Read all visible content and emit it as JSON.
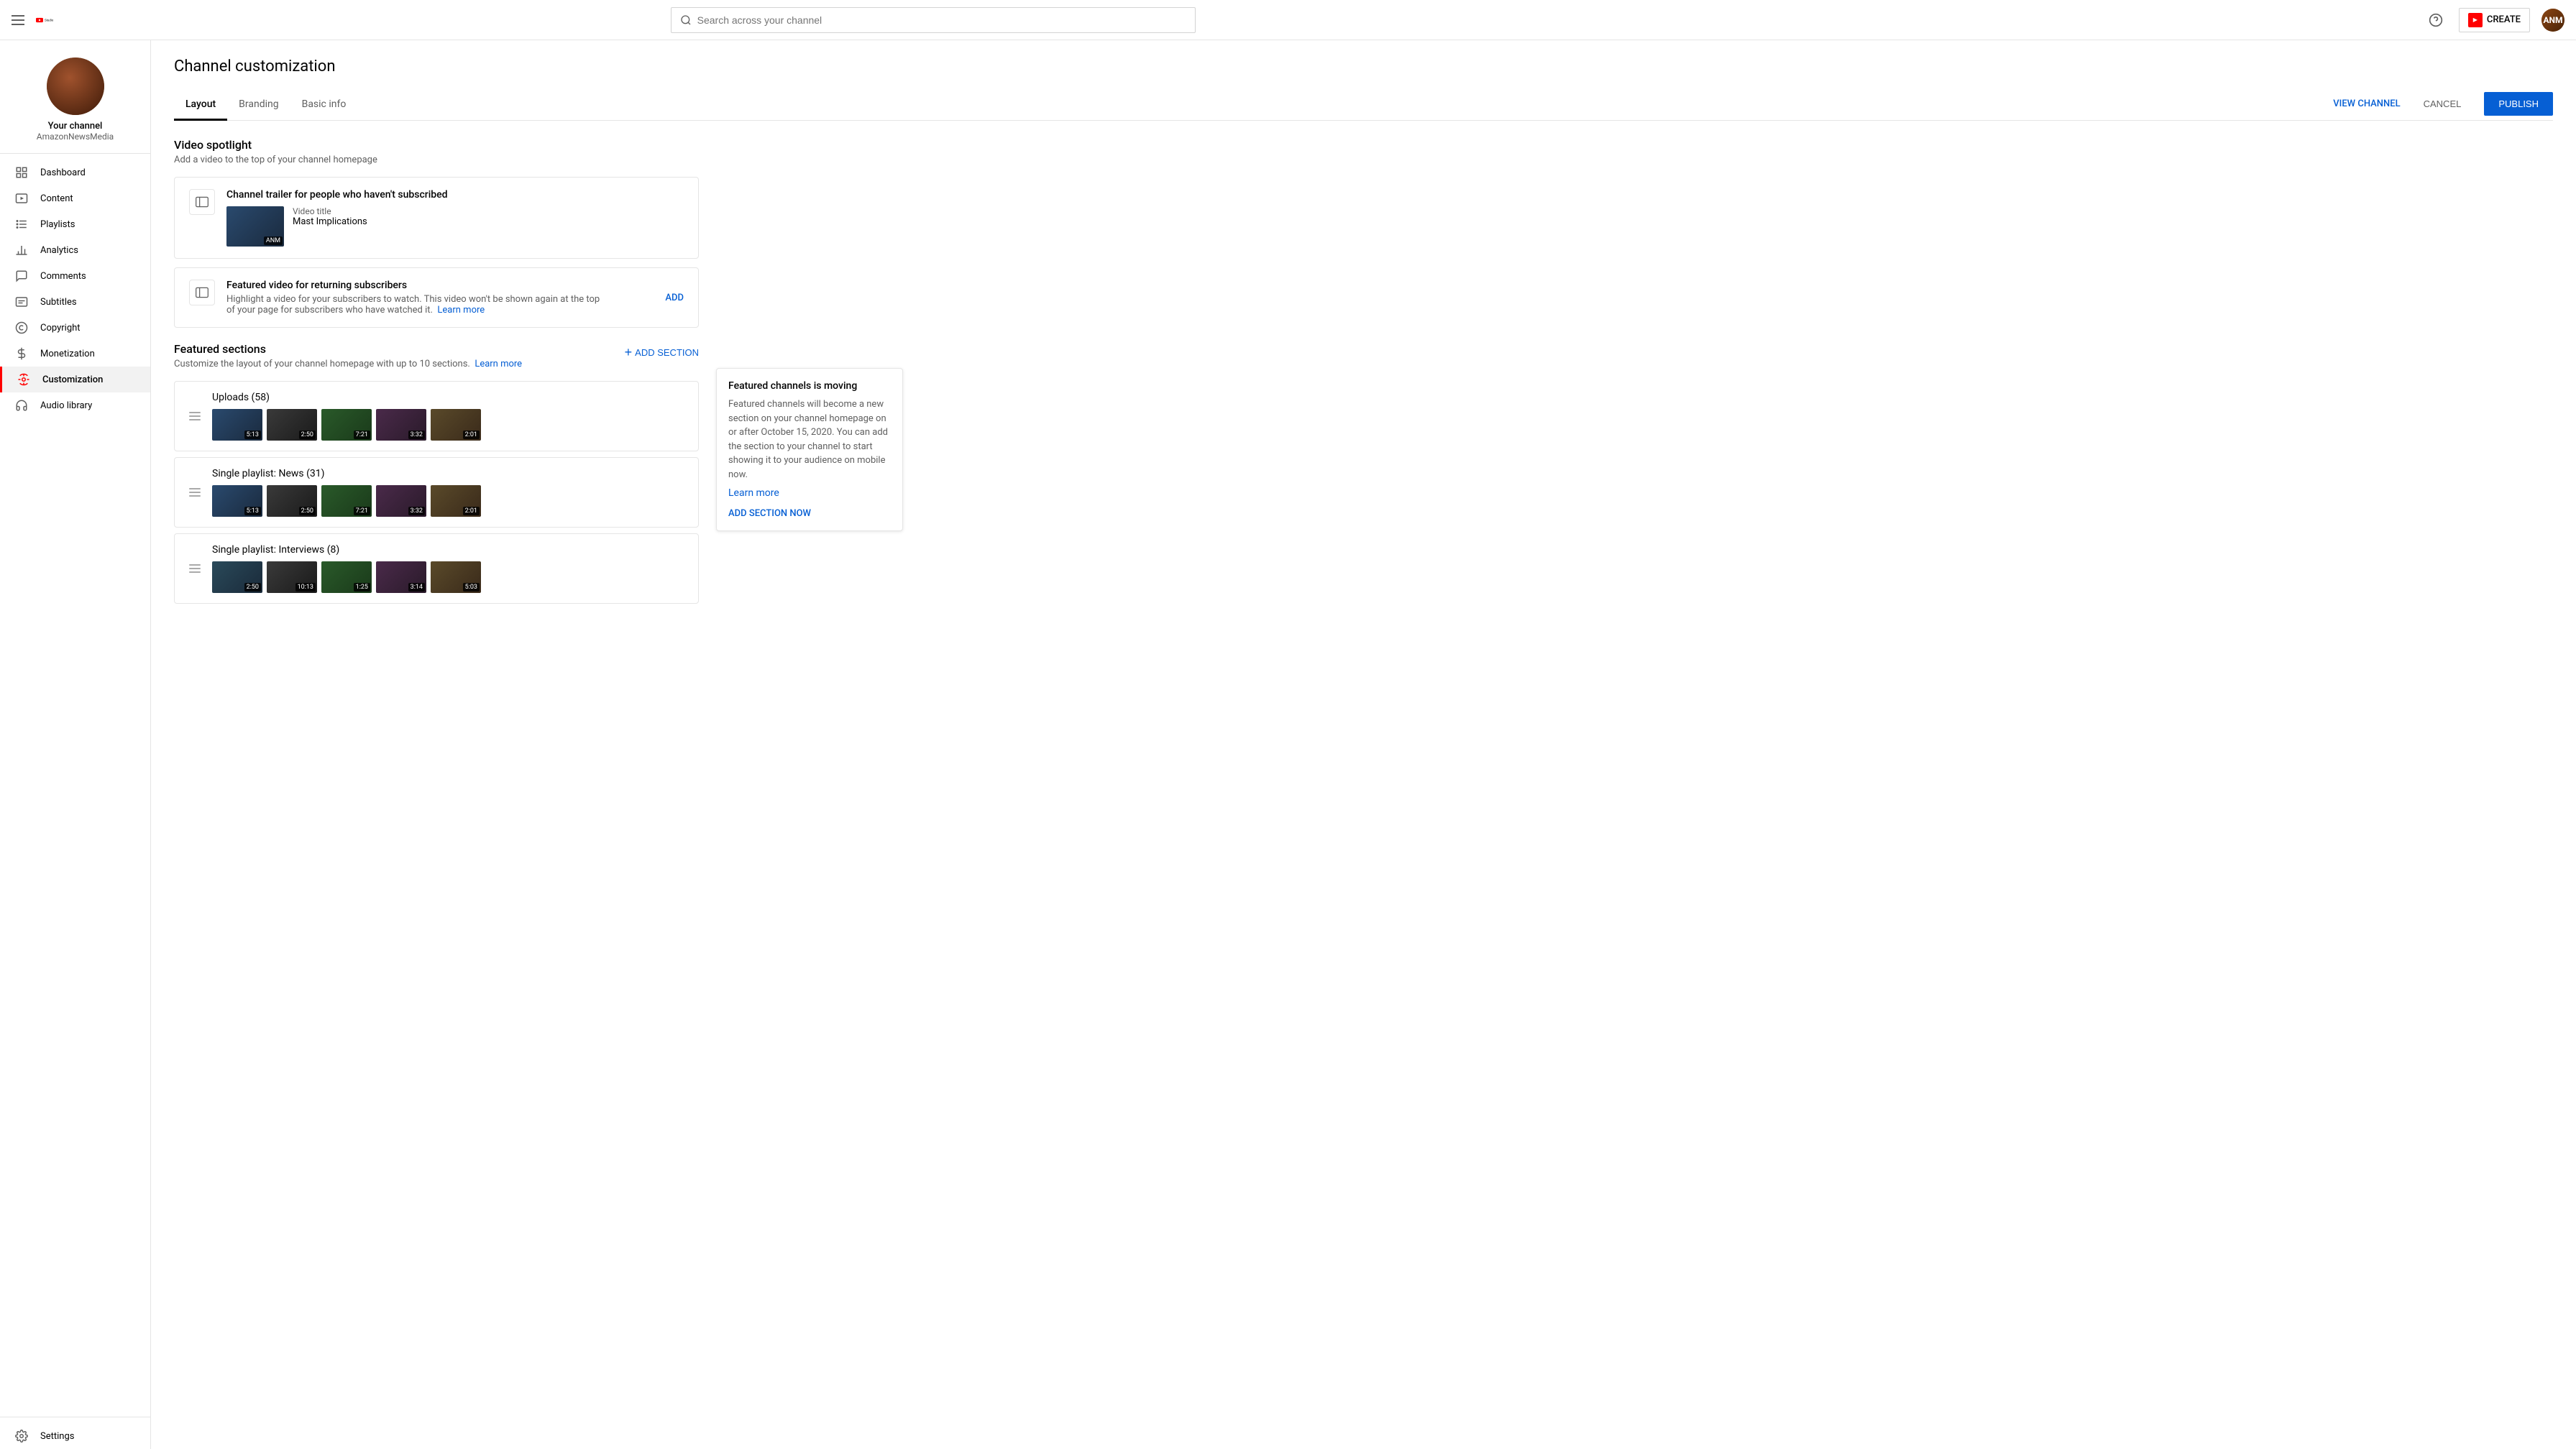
{
  "navbar": {
    "menu_label": "Menu",
    "logo_text": "Studio",
    "search_placeholder": "Search across your channel",
    "create_label": "CREATE",
    "help_icon": "help-circle-icon",
    "avatar_initials": "ANM"
  },
  "sidebar": {
    "channel_name": "Your channel",
    "channel_handle": "AmazonNewsMedia",
    "items": [
      {
        "id": "dashboard",
        "label": "Dashboard",
        "icon": "grid-icon"
      },
      {
        "id": "content",
        "label": "Content",
        "icon": "play-icon"
      },
      {
        "id": "playlists",
        "label": "Playlists",
        "icon": "list-icon"
      },
      {
        "id": "analytics",
        "label": "Analytics",
        "icon": "bar-chart-icon"
      },
      {
        "id": "comments",
        "label": "Comments",
        "icon": "comment-icon"
      },
      {
        "id": "subtitles",
        "label": "Subtitles",
        "icon": "subtitles-icon"
      },
      {
        "id": "copyright",
        "label": "Copyright",
        "icon": "copyright-icon"
      },
      {
        "id": "monetization",
        "label": "Monetization",
        "icon": "dollar-icon"
      },
      {
        "id": "customization",
        "label": "Customization",
        "icon": "customization-icon",
        "active": true
      },
      {
        "id": "audio-library",
        "label": "Audio library",
        "icon": "headphone-icon"
      }
    ],
    "settings": {
      "label": "Settings",
      "icon": "gear-icon"
    }
  },
  "page": {
    "title": "Channel customization",
    "tabs": [
      {
        "id": "layout",
        "label": "Layout",
        "active": true
      },
      {
        "id": "branding",
        "label": "Branding",
        "active": false
      },
      {
        "id": "basic-info",
        "label": "Basic info",
        "active": false
      }
    ],
    "actions": {
      "view_channel": "VIEW CHANNEL",
      "cancel": "CANCEL",
      "publish": "PUBLISH"
    }
  },
  "video_spotlight": {
    "title": "Video spotlight",
    "description": "Add a video to the top of your channel homepage",
    "channel_trailer": {
      "title": "Channel trailer for people who haven't subscribed",
      "video_title_label": "Video title",
      "video_title": "Mast Implications"
    },
    "featured_video": {
      "title": "Featured video for returning subscribers",
      "description": "Highlight a video for your subscribers to watch. This video won't be shown again at the top of your page for subscribers who have watched it.",
      "learn_more": "Learn more",
      "add_label": "ADD"
    }
  },
  "featured_sections": {
    "title": "Featured sections",
    "description": "Customize the layout of your channel homepage with up to 10 sections.",
    "learn_more": "Learn more",
    "add_section": "+ ADD SECTION",
    "sections": [
      {
        "label": "Uploads (58)",
        "thumbs": [
          {
            "time": "5:13",
            "color": "thumb-1"
          },
          {
            "time": "2:50",
            "color": "thumb-2"
          },
          {
            "time": "7:21",
            "color": "thumb-3"
          },
          {
            "time": "3:32",
            "color": "thumb-4"
          },
          {
            "time": "2:01",
            "color": "thumb-5"
          }
        ]
      },
      {
        "label": "Single playlist: News (31)",
        "thumbs": [
          {
            "time": "5:13",
            "color": "thumb-1"
          },
          {
            "time": "2:50",
            "color": "thumb-2"
          },
          {
            "time": "7:21",
            "color": "thumb-3"
          },
          {
            "time": "3:32",
            "color": "thumb-4"
          },
          {
            "time": "2:01",
            "color": "thumb-5"
          }
        ]
      },
      {
        "label": "Single playlist: Interviews (8)",
        "thumbs": [
          {
            "time": "2:50",
            "color": "thumb-6"
          },
          {
            "time": "10:13",
            "color": "thumb-2"
          },
          {
            "time": "1:25",
            "color": "thumb-3"
          },
          {
            "time": "3:14",
            "color": "thumb-4"
          },
          {
            "time": "5:03",
            "color": "thumb-5"
          }
        ]
      }
    ]
  },
  "popover": {
    "title": "Featured channels is moving",
    "text": "Featured channels will become a new section on your channel homepage on or after October 15, 2020. You can add the section to your channel to start showing it to your audience on mobile now.",
    "learn_more": "Learn more",
    "cta": "ADD SECTION NOW"
  }
}
